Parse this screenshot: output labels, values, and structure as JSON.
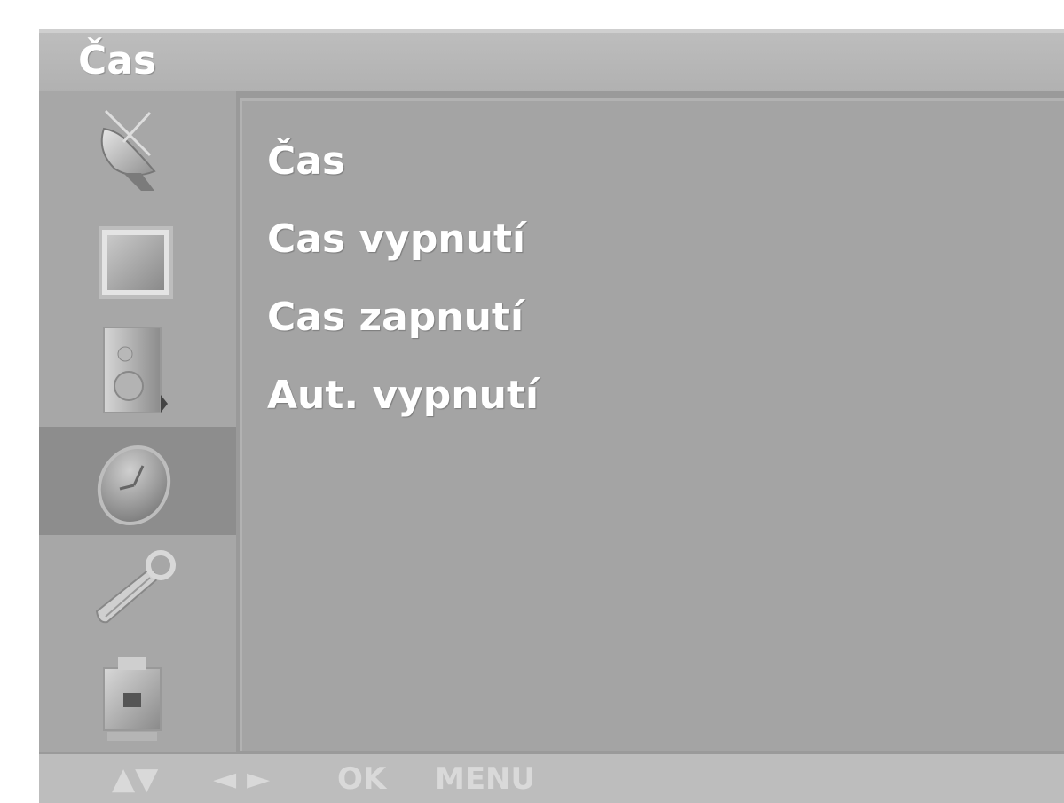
{
  "header": {
    "title": "Čas"
  },
  "sidebar": {
    "items": [
      {
        "icon": "satellite-dish-icon"
      },
      {
        "icon": "picture-icon"
      },
      {
        "icon": "speaker-icon"
      },
      {
        "icon": "clock-icon",
        "selected": true
      },
      {
        "icon": "wrench-icon"
      },
      {
        "icon": "lock-icon"
      }
    ]
  },
  "menu": {
    "items": [
      {
        "label": "Čas"
      },
      {
        "label": "Cas vypnutí"
      },
      {
        "label": "Cas zapnutí"
      },
      {
        "label": "Aut. vypnutí"
      }
    ]
  },
  "footer": {
    "nav_updown": "▲▼",
    "nav_leftright": "◄ ►",
    "ok": "OK",
    "menu": "MENU"
  },
  "colors": {
    "background": "#9a9a9a",
    "panel": "#a4a4a4",
    "selected": "#8d8d8d",
    "text": "#ffffff"
  }
}
